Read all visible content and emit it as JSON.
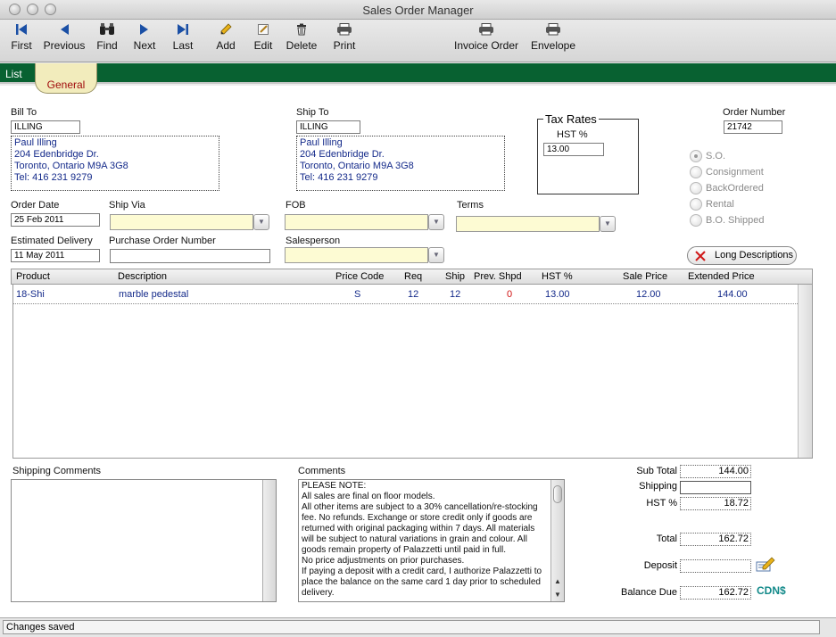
{
  "window": {
    "title": "Sales Order Manager"
  },
  "toolbar": {
    "first": "First",
    "previous": "Previous",
    "find": "Find",
    "next": "Next",
    "last": "Last",
    "add": "Add",
    "edit": "Edit",
    "delete": "Delete",
    "print": "Print",
    "invoice_order": "Invoice Order",
    "envelope": "Envelope"
  },
  "tabs": {
    "list": "List",
    "general": "General"
  },
  "bill_to": {
    "label": "Bill To",
    "code": "ILLING",
    "lines": [
      "Paul Illing",
      "204 Edenbridge  Dr.",
      "Toronto, Ontario    M9A 3G8",
      "Tel: 416 231 9279"
    ]
  },
  "ship_to": {
    "label": "Ship To",
    "code": "ILLING",
    "lines": [
      "Paul Illing",
      "204 Edenbridge  Dr.",
      "Toronto, Ontario    M9A 3G8",
      "Tel: 416 231 9279"
    ]
  },
  "tax_rates": {
    "title": "Tax Rates",
    "hst_label": "HST %",
    "hst_value": "13.00"
  },
  "order_number": {
    "label": "Order Number",
    "value": "21742"
  },
  "order_type": {
    "options": [
      "S.O.",
      "Consignment",
      "BackOrdered",
      "Rental",
      "B.O. Shipped"
    ],
    "selected": "S.O."
  },
  "order_date": {
    "label": "Order Date",
    "value": "25 Feb 2011"
  },
  "ship_via": {
    "label": "Ship Via",
    "value": ""
  },
  "fob": {
    "label": "FOB",
    "value": ""
  },
  "terms": {
    "label": "Terms",
    "value": ""
  },
  "estimated_delivery": {
    "label": "Estimated Delivery",
    "value": "11 May 2011"
  },
  "purchase_order_number": {
    "label": "Purchase Order Number",
    "value": ""
  },
  "salesperson": {
    "label": "Salesperson",
    "value": ""
  },
  "long_descriptions": {
    "label": "Long Descriptions"
  },
  "grid": {
    "columns": {
      "product": "Product",
      "description": "Description",
      "price_code": "Price Code",
      "req": "Req",
      "ship": "Ship",
      "prev_shpd": "Prev. Shpd",
      "hst": "HST %",
      "sale_price": "Sale Price",
      "extended_price": "Extended Price"
    },
    "rows": [
      {
        "product": "18-Shi",
        "description": "marble pedestal",
        "price_code": "S",
        "req": "12",
        "ship": "12",
        "prev_shpd": "0",
        "hst": "13.00",
        "sale_price": "12.00",
        "extended_price": "144.00"
      }
    ]
  },
  "shipping_comments": {
    "label": "Shipping Comments",
    "value": ""
  },
  "comments": {
    "label": "Comments",
    "lines": [
      "PLEASE NOTE:",
      "All sales are final on floor models.",
      "All other items are subject to a 30% cancellation/re-stocking",
      "fee.  No refunds.  Exchange or store credit only if goods are",
      "returned with original packaging within 7 days.  All materials",
      "will be subject to natural variations in grain and colour.  All",
      "goods remain property of Palazzetti until paid in full.",
      "No price adjustments on prior purchases.",
      "If paying a deposit with a credit card, I authorize Palazzetti to",
      "place the balance on the same card 1 day prior to scheduled",
      "delivery."
    ]
  },
  "totals": {
    "sub_total_label": "Sub Total",
    "sub_total": "144.00",
    "shipping_label": "Shipping",
    "shipping": "",
    "hst_label": "HST %",
    "hst": "18.72",
    "total_label": "Total",
    "total": "162.72",
    "deposit_label": "Deposit",
    "deposit": "",
    "balance_due_label": "Balance Due",
    "balance_due": "162.72",
    "currency": "CDN$"
  },
  "status": {
    "message": "Changes saved"
  },
  "colors": {
    "tab_bar": "#086131",
    "general_tab": "#f2ecbc",
    "general_tab_text": "#a10d0d",
    "address_text": "#142a8a",
    "combo_fill": "#fdfbd3",
    "currency_text": "#138a8a",
    "prev_shpd_text": "#d01010"
  }
}
